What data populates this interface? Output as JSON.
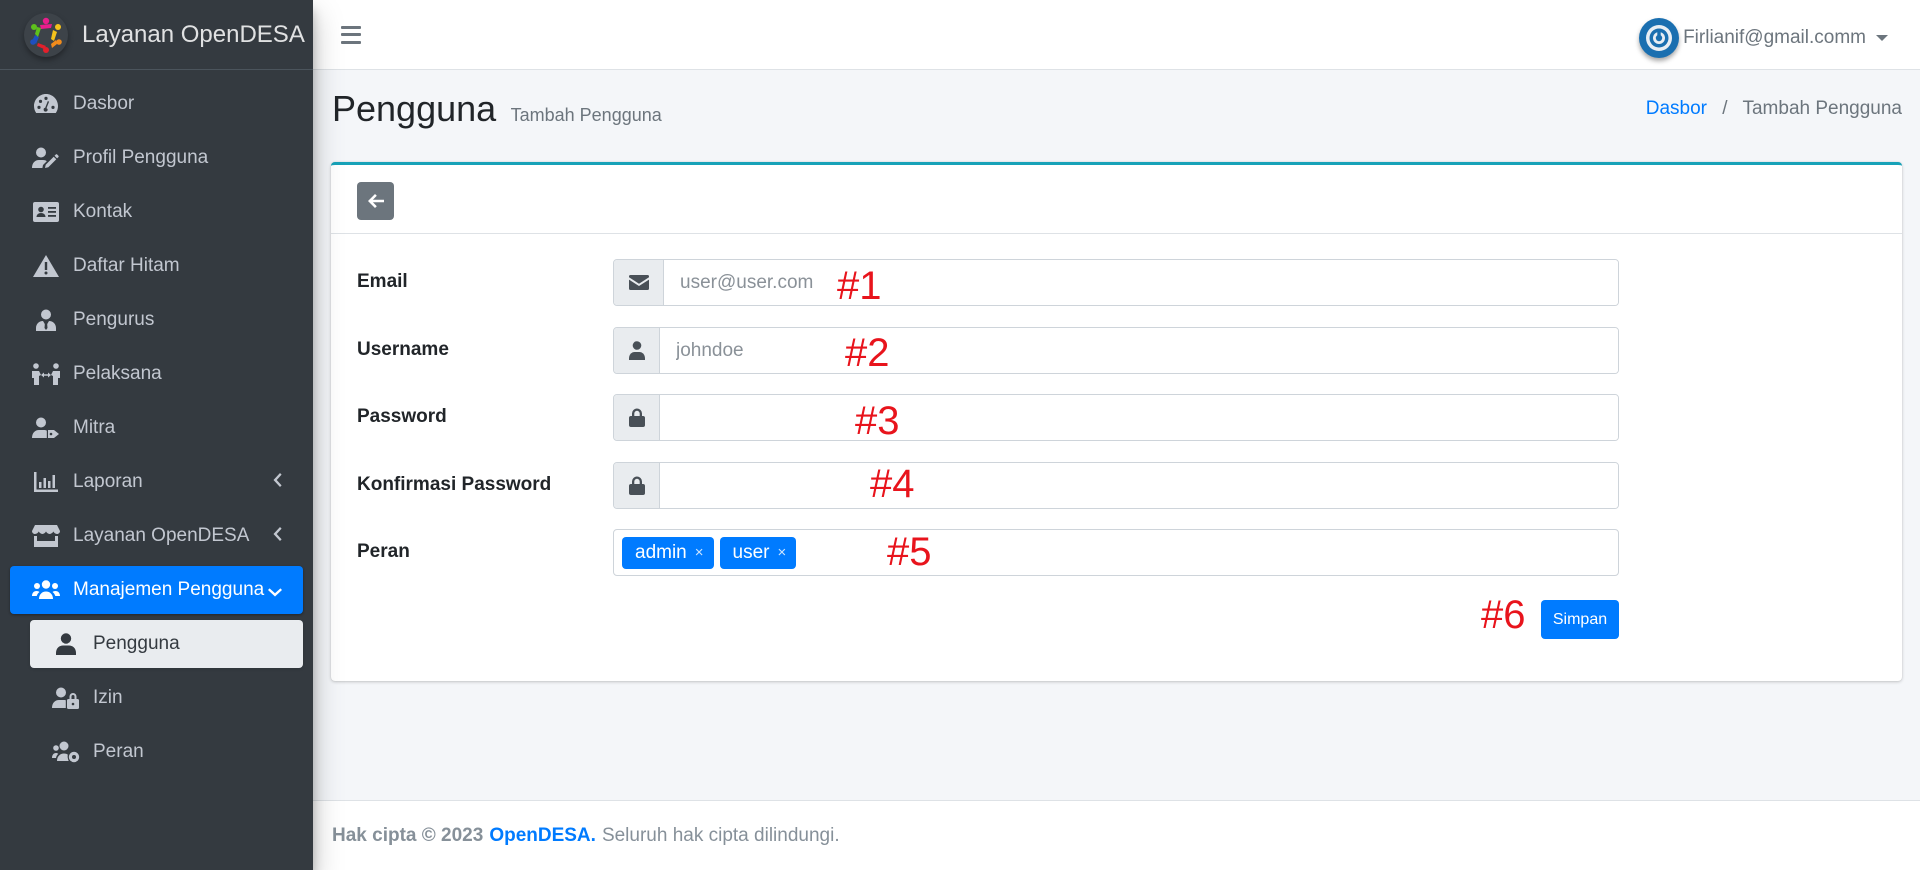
{
  "brand": {
    "title": "Layanan OpenDESA",
    "logo_icon": "opendesa-logo"
  },
  "sidebar": {
    "items": [
      {
        "label": "Dasbor",
        "icon": "tachometer-icon"
      },
      {
        "label": "Profil Pengguna",
        "icon": "user-edit-icon"
      },
      {
        "label": "Kontak",
        "icon": "id-card-icon"
      },
      {
        "label": "Daftar Hitam",
        "icon": "warning-icon"
      },
      {
        "label": "Pengurus",
        "icon": "user-tie-icon"
      },
      {
        "label": "Pelaksana",
        "icon": "people-arrows-icon"
      },
      {
        "label": "Mitra",
        "icon": "user-tag-icon"
      },
      {
        "label": "Laporan",
        "icon": "chart-bar-icon",
        "chevron": "chevron-left-icon"
      },
      {
        "label": "Layanan OpenDESA",
        "icon": "store-icon",
        "chevron": "chevron-left-icon"
      },
      {
        "label": "Manajemen Pengguna",
        "icon": "users-icon",
        "chevron": "chevron-down-icon",
        "active": true
      }
    ],
    "sub_items": [
      {
        "label": "Pengguna",
        "icon": "user-icon",
        "active": true
      },
      {
        "label": "Izin",
        "icon": "user-lock-icon"
      },
      {
        "label": "Peran",
        "icon": "users-cog-icon"
      }
    ]
  },
  "navbar": {
    "menu_icon": "hamburger-icon",
    "user_email": "Firlianif@gmail.comm"
  },
  "header": {
    "title": "Pengguna",
    "subtitle": "Tambah Pengguna",
    "breadcrumb": [
      {
        "label": "Dasbor",
        "link": true
      },
      {
        "label": "Tambah Pengguna",
        "link": false
      }
    ],
    "breadcrumb_separator": "/"
  },
  "form": {
    "back_icon": "arrow-left-icon",
    "fields": {
      "email": {
        "label": "Email",
        "placeholder": "user@user.com",
        "value": ""
      },
      "username": {
        "label": "Username",
        "placeholder": "johndoe",
        "value": ""
      },
      "password": {
        "label": "Password",
        "placeholder": "",
        "value": ""
      },
      "password_confirm": {
        "label": "Konfirmasi Password",
        "placeholder": "",
        "value": ""
      },
      "roles": {
        "label": "Peran",
        "tags": [
          "admin",
          "user"
        ],
        "remove_glyph": "×"
      }
    },
    "save_label": "Simpan"
  },
  "annotations": [
    "#1",
    "#2",
    "#3",
    "#4",
    "#5",
    "#6"
  ],
  "footer": {
    "prefix": "Hak cipta © 2023",
    "brand": "OpenDESA.",
    "suffix": "Seluruh hak cipta dilindungi."
  },
  "colors": {
    "sidebar_bg": "#343a40",
    "primary": "#007bff",
    "card_accent": "#17a2b8",
    "annotation": "#e8141c"
  }
}
